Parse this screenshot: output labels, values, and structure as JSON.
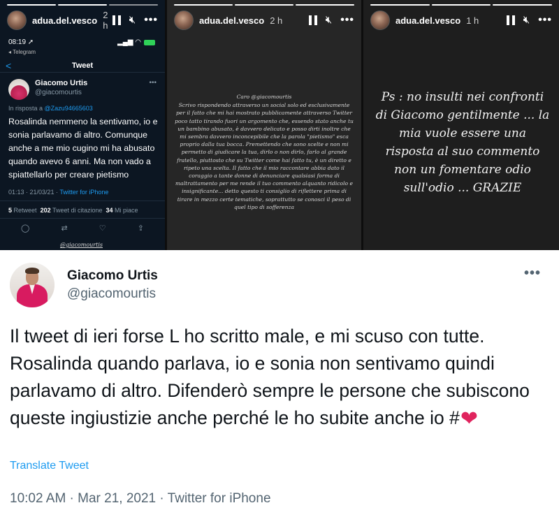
{
  "stories": [
    {
      "username": "adua.del.vesco",
      "time": "2 h",
      "screenshot": {
        "status_time": "08:19 ➚",
        "status_sub": "◂ Telegram",
        "nav_back": "<",
        "nav_title": "Tweet",
        "author_name": "Giacomo Urtis",
        "author_handle": "@giacomourtis",
        "reply_prefix": "In risposta a",
        "reply_to": "@Zazu94665603",
        "text": "Rosalinda nemmeno la sentivamo, io e sonia parlavamo di altro. Comunque anche a me mio cugino mi ha abusato quando avevo 6 anni. Ma non vado a spiattellarlo per creare pietismo",
        "meta_time": "01:13 · 21/03/21 ·",
        "meta_source": "Twitter for iPhone",
        "retweets_num": "5",
        "retweets_label": "Retweet",
        "quotes_num": "202",
        "quotes_label": "Tweet di citazione",
        "likes_num": "34",
        "likes_label": "Mi piace",
        "tag": "@giacomourtis"
      }
    },
    {
      "username": "adua.del.vesco",
      "time": "2 h",
      "salutation": "Caro @giacomourtis",
      "letter": "Scrivo rispondendo attraverso un social solo ed esclusivamente per il fatto che mi hai mostrato pubblicamente attraverso Twitter poco tatto tirando fuori un argomento che, essendo stato anche tu un bambino abusato, è davvero delicato e posso dirti inoltre che mi sembra davvero inconcepibile che la parola \"pietismo\" esca proprio dalla tua bocca. Premettendo che sono scelte e non mi permetto di giudicare la tua, dirlo o non dirlo, farlo al grande fratello, piuttosto che su Twitter come hai fatto tu, è un diretto e ripeto una scelta. Il fatto che il mio raccontare abbia dato il coraggio a tante donne di denunciare qualsiasi forma di maltrattamento per me rende il tuo commento alquanto ridicolo e insignificante... detto questo ti consiglio di riflettere prima di tirare in mezzo certe tematiche, soprattutto se conosci il peso di quel tipo di sofferenza"
    },
    {
      "username": "adua.del.vesco",
      "time": "1 h",
      "text": "Ps : no insulti nei confronti di Giacomo gentilmente ... la mia vuole essere una risposta al suo commento non un fomentare odio sull'odio ... GRAZIE"
    }
  ],
  "tweet": {
    "name": "Giacomo Urtis",
    "handle": "@giacomourtis",
    "more": "•••",
    "text": "Il tweet di ieri forse L ho scritto male, e mi scuso con tutte. Rosalinda quando parlava, io e sonia non sentivamo quindi parlavamo di altro. Difenderò sempre le persone che subiscono queste ingiustizie anche perché le ho subite anche io #",
    "heart": "❤",
    "translate": "Translate Tweet",
    "meta": "10:02 AM · Mar 21, 2021 · Twitter for iPhone"
  },
  "icons": {
    "pause": "pause-icon",
    "mute": "mute-icon",
    "more": "more-icon",
    "heart_color": "#e0245e",
    "link_color": "#1d9bf0"
  }
}
